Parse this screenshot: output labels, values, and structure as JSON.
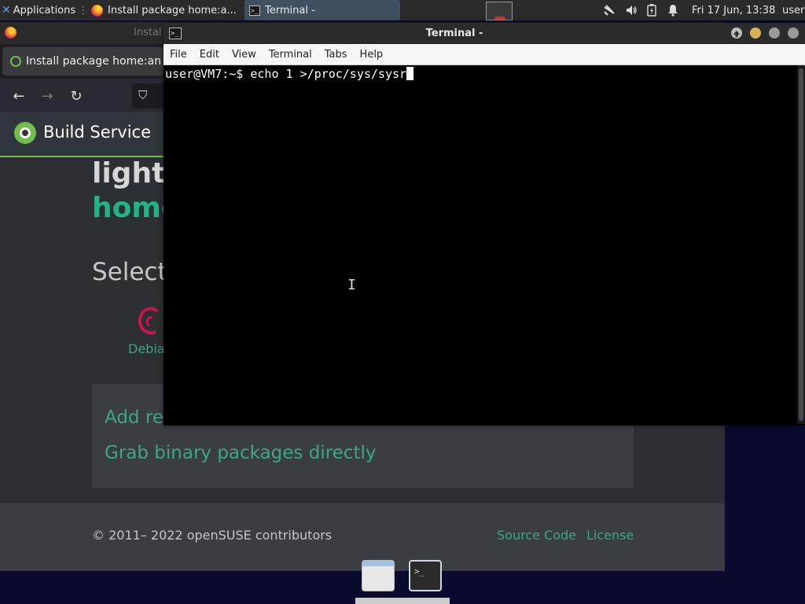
{
  "panel": {
    "applications_label": "Applications",
    "tasks": [
      {
        "label": "Install package home:a..."
      },
      {
        "label": "Terminal -"
      }
    ],
    "datetime": "Fri 17 Jun, 13:38",
    "user": "user"
  },
  "browser": {
    "title_fragment": "Instal",
    "tab_label": "Install package home:an",
    "obs_title": "Build Service",
    "heading_line1": "light",
    "heading_line2": "home",
    "select_text": "Select",
    "debian_label": "Debia",
    "card_link1": "Add re",
    "card_link2": "Grab binary packages directly",
    "footer_copyright": "© 2011– 2022 openSUSE contributors",
    "footer_source": "Source Code",
    "footer_license": "License"
  },
  "terminal": {
    "window_title": "Terminal -",
    "menu": [
      "File",
      "Edit",
      "View",
      "Terminal",
      "Tabs",
      "Help"
    ],
    "prompt": "user@VM7:~$ ",
    "command": "echo 1 >/proc/sys/sysr"
  },
  "colors": {
    "accent_green": "#3ea58c",
    "obs_green": "#6fbf4a",
    "panel_bg": "#2b2b2b"
  }
}
